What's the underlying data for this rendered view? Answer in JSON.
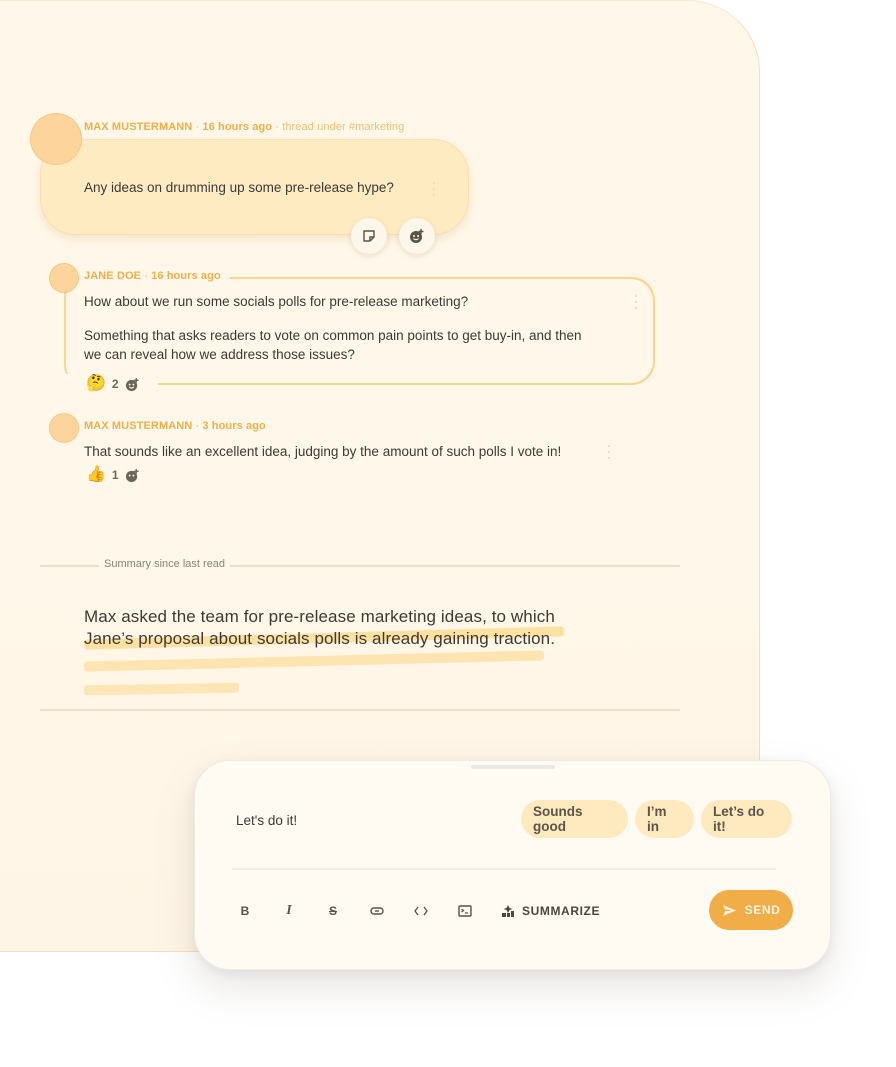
{
  "thread": {
    "context_label": "thread under #marketing",
    "messages": [
      {
        "author": "MAX MUSTERMANN",
        "time": "16 hours ago",
        "text": "Any ideas on drumming up some pre-release hype?",
        "actions": [
          "note-icon",
          "add-reaction-icon"
        ]
      },
      {
        "author": "JANE DOE",
        "time": "16 hours ago",
        "text_lines": [
          "How about we run some socials polls for pre-release marketing?",
          "Something that asks readers to vote on common pain points to get buy-in, and then",
          "we can reveal how we address those issues?"
        ],
        "reactions": [
          {
            "emoji": "🤔",
            "icon": "thinking-face-icon",
            "count": "2"
          }
        ]
      },
      {
        "author": "MAX MUSTERMANN",
        "time": "3 hours ago",
        "text": "That sounds like an excellent idea, judging by the amount of such polls I vote in!",
        "reactions": [
          {
            "emoji": "👍",
            "icon": "thumbs-up-icon",
            "count": "1"
          }
        ]
      }
    ],
    "separator": "·"
  },
  "summary": {
    "label": "Summary since last read",
    "text": "Max asked the team for pre-release marketing ideas, to which Jane’s proposal about socials polls is already gaining traction."
  },
  "composer": {
    "input_value": "Let's do it!",
    "suggestions": [
      "Sounds good",
      "I’m in",
      "Let’s do it!"
    ],
    "toolbar": {
      "bold": "B",
      "italic": "I",
      "strike": "S",
      "summarize_label": "SUMMARIZE",
      "send_label": "SEND"
    }
  },
  "colors": {
    "accent": "#f0ad48",
    "author": "#eeb048",
    "panel_bg": "#fff8ea",
    "bubble_bg": "#ffebc2",
    "chip_bg": "#ffe9bf",
    "avatar": "#fdd49c"
  }
}
